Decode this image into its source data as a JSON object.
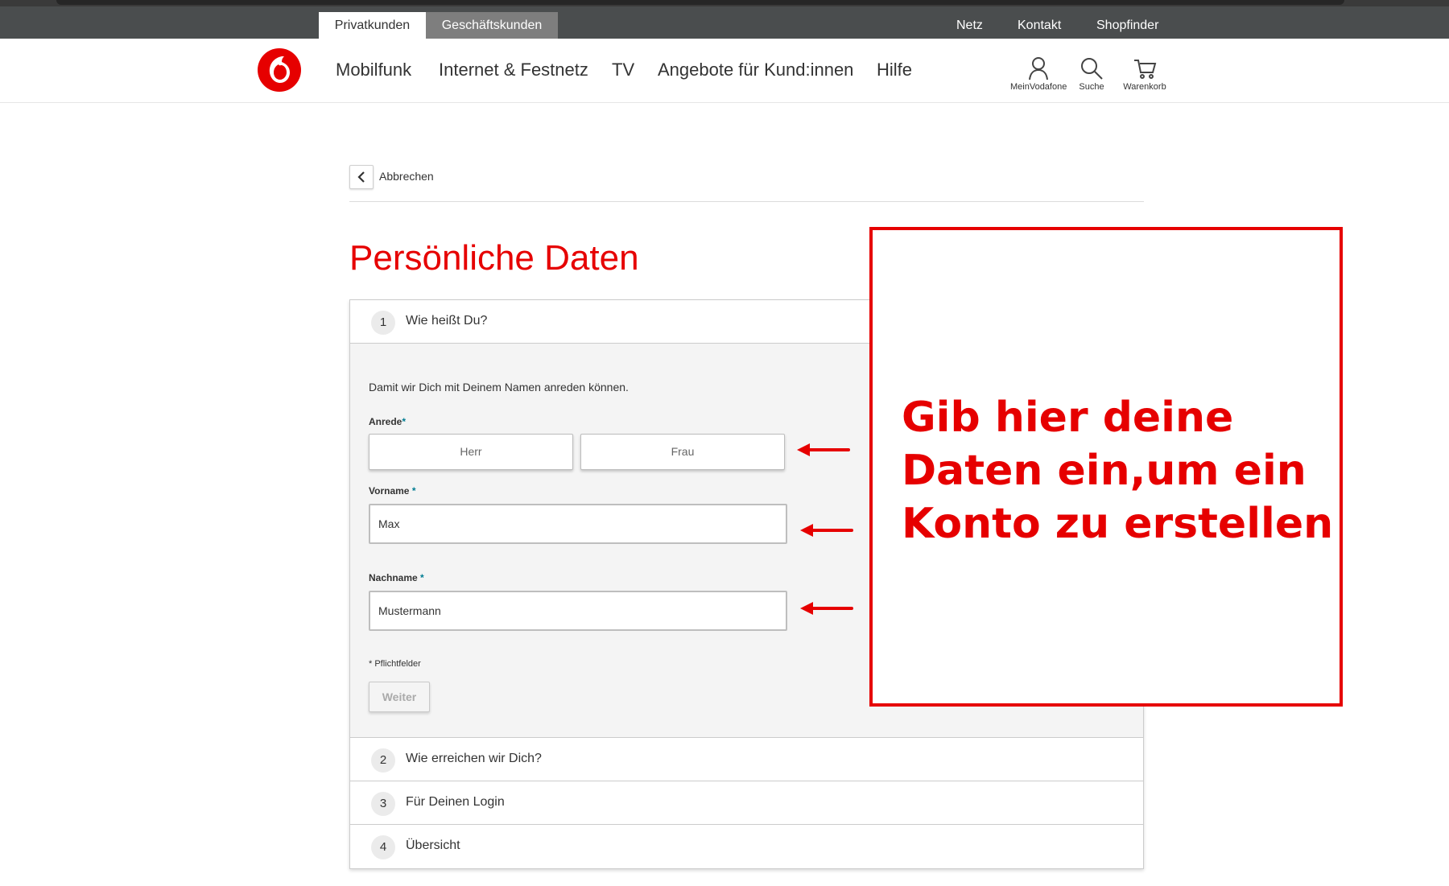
{
  "top_bar": {
    "segments": [
      "Privatkunden",
      "Geschäftskunden"
    ],
    "links": [
      "Netz",
      "Kontakt",
      "Shopfinder"
    ]
  },
  "main_nav": {
    "links": [
      "Mobilfunk",
      "Internet & Festnetz",
      "TV",
      "Angebote für Kund:innen",
      "Hilfe"
    ],
    "icons": [
      {
        "icon": "user-icon",
        "label": "MeinVodafone"
      },
      {
        "icon": "search-icon",
        "label": "Suche"
      },
      {
        "icon": "cart-icon",
        "label": "Warenkorb"
      }
    ]
  },
  "back": {
    "label": "Abbrechen"
  },
  "page_title": "Persönliche Daten",
  "steps": [
    {
      "number": "1",
      "title": "Wie heißt Du?"
    },
    {
      "number": "2",
      "title": "Wie erreichen wir Dich?"
    },
    {
      "number": "3",
      "title": "Für Deinen Login"
    },
    {
      "number": "4",
      "title": "Übersicht"
    }
  ],
  "form": {
    "intro": "Damit wir Dich mit Deinem Namen anreden können.",
    "salutation_label": "Anrede",
    "salutation_options": [
      "Herr",
      "Frau"
    ],
    "first_name_label": "Vorname",
    "first_name_value": "Max",
    "last_name_label": "Nachname",
    "last_name_value": "Mustermann",
    "required_marker": "*",
    "required_note": "* Pflichtfelder",
    "submit_label": "Weiter"
  },
  "annotation": {
    "text": "Gib hier deine Daten ein,um ein Konto zu erstellen",
    "color": "#e60000"
  },
  "colors": {
    "brand": "#e60000",
    "topbar": "#4a4d4e",
    "required_star": "#007c92"
  }
}
